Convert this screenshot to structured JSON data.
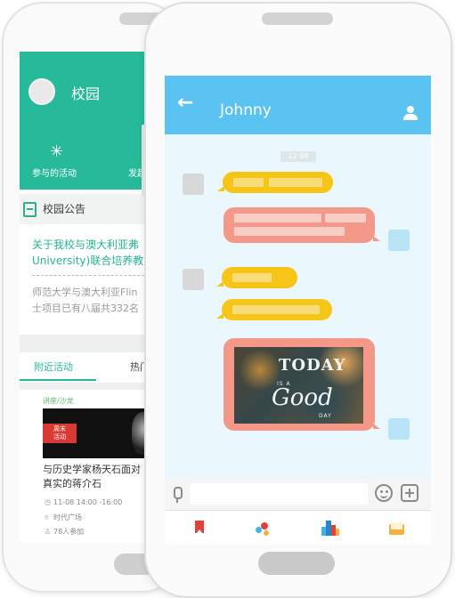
{
  "campus_app": {
    "title": "校园",
    "activities": [
      {
        "label": "参与的活动"
      },
      {
        "label": "发起"
      }
    ],
    "notice": {
      "section_title": "校园公告",
      "headline_lines": [
        "关于我校与澳大利亚弗",
        "University)联合培养教"
      ],
      "body_lines": [
        "师范大学与澳大利亚Flin",
        "士项目已有八届共332名"
      ]
    },
    "tabs": [
      {
        "label": "附近活动",
        "active": true
      },
      {
        "label": "热门",
        "active": false
      }
    ],
    "event": {
      "tag": "讲座/沙龙",
      "badge": "周末活动",
      "title_lines": [
        "与历史学家杨天石面对",
        "真实的蒋介石"
      ],
      "time": "11-08 14:00 -16:00",
      "place": "时代广场",
      "participants": "78人参加"
    },
    "brand_color": "#26b99a"
  },
  "chat_app": {
    "contact_name": "Johnny",
    "timestamp": "12:48",
    "header_color": "#5bc3f2",
    "incoming_bubble_color": "#f5c518",
    "outgoing_bubble_color": "#f4998a",
    "image_message": {
      "line1": "TODAY",
      "line2": "IS A",
      "line3": "Good",
      "line4": "DAY"
    },
    "input": {
      "value": "",
      "placeholder": ""
    },
    "bottom_nav": [
      {
        "icon": "bookmark-icon"
      },
      {
        "icon": "rocket-icon"
      },
      {
        "icon": "city-icon"
      },
      {
        "icon": "mail-icon"
      }
    ]
  }
}
